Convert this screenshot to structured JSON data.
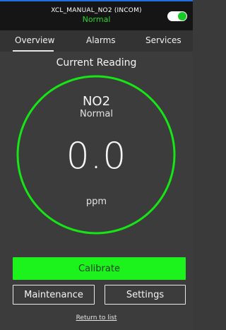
{
  "header": {
    "device_name": "XCL_MANUAL_NO2 (INCOM)",
    "device_status": "Normal",
    "toggle_state": "on"
  },
  "tabs": [
    {
      "label": "Overview",
      "active": true
    },
    {
      "label": "Alarms",
      "active": false
    },
    {
      "label": "Services",
      "active": false
    }
  ],
  "main": {
    "section_title": "Current Reading",
    "gas": "NO2",
    "gas_status": "Normal",
    "reading": "0.0",
    "unit": "ppm"
  },
  "actions": {
    "calibrate": "Calibrate",
    "maintenance": "Maintenance",
    "settings": "Settings",
    "return_link": "Return to list"
  },
  "colors": {
    "accent_green": "#1cf21c",
    "status_green": "#2bd42b",
    "header_bg": "#151515",
    "top_accent": "#1e6fe0"
  }
}
